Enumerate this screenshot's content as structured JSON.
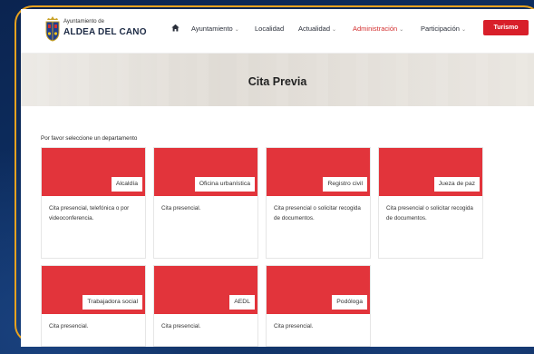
{
  "site": {
    "logo_top": "Ayuntamiento de",
    "logo_name": "ALDEA DEL CANO"
  },
  "nav": {
    "items": [
      {
        "label": "Ayuntamiento",
        "dropdown": true
      },
      {
        "label": "Localidad",
        "dropdown": false
      },
      {
        "label": "Actualidad",
        "dropdown": true
      },
      {
        "label": "Administración",
        "dropdown": true,
        "active": true
      },
      {
        "label": "Participación",
        "dropdown": true
      }
    ],
    "cta": "Turismo"
  },
  "hero": {
    "title": "Cita Previa"
  },
  "content": {
    "prompt": "Por favor seleccione un departamento",
    "departments": [
      {
        "label": "Alcaldía",
        "desc": "Cita presencial, telefónica o por videoconferencia."
      },
      {
        "label": "Oficina urbanística",
        "desc": "Cita presencial."
      },
      {
        "label": "Registro civil",
        "desc": "Cita presencial o solicitar recogida de documentos."
      },
      {
        "label": "Jueza de paz",
        "desc": "Cita presencial o solicitar recogida de documentos."
      },
      {
        "label": "Trabajadora social",
        "desc": "Cita presencial."
      },
      {
        "label": "AEDL",
        "desc": "Cita presencial."
      },
      {
        "label": "Podóloga",
        "desc": "Cita presencial."
      }
    ]
  },
  "colors": {
    "accent": "#e2343b",
    "cta": "#d81f2a",
    "frame": "#e8a21f",
    "background": "#0c2a55"
  }
}
